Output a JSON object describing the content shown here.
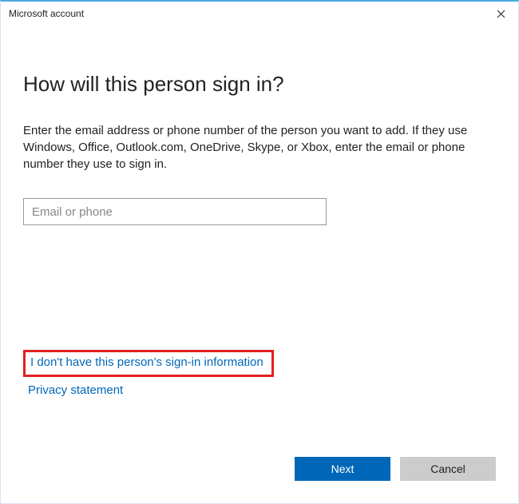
{
  "titlebar": {
    "title": "Microsoft account"
  },
  "main": {
    "heading": "How will this person sign in?",
    "description": "Enter the email address or phone number of the person you want to add. If they use Windows, Office, Outlook.com, OneDrive, Skype, or Xbox, enter the email or phone number they use to sign in.",
    "input_placeholder": "Email or phone",
    "input_value": ""
  },
  "links": {
    "no_signin_info": "I don't have this person's sign-in information",
    "privacy": "Privacy statement"
  },
  "footer": {
    "next": "Next",
    "cancel": "Cancel"
  }
}
